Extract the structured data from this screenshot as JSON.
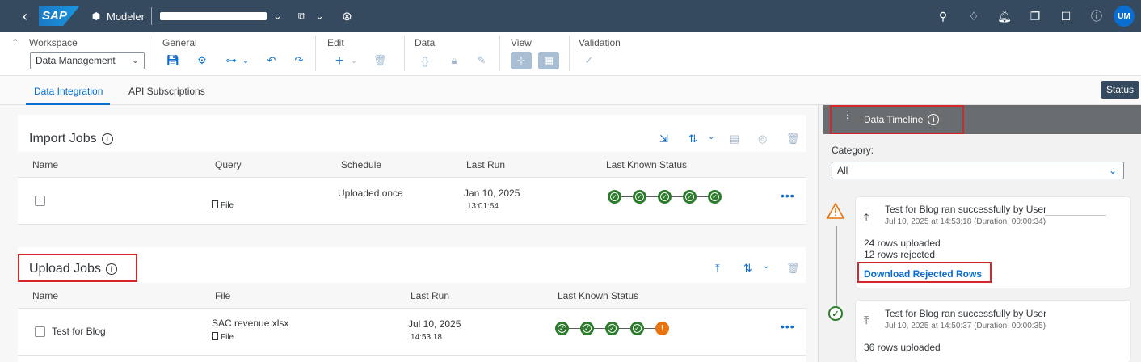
{
  "shell": {
    "logo": "SAP",
    "app_name": "Modeler",
    "avatar_initials": "UM"
  },
  "toolbar": {
    "workspace_label": "Workspace",
    "workspace_value": "Data Management",
    "general_label": "General",
    "edit_label": "Edit",
    "data_label": "Data",
    "view_label": "View",
    "validation_label": "Validation"
  },
  "tabs": {
    "data_integration": "Data Integration",
    "api_subscriptions": "API Subscriptions",
    "status_button": "Status"
  },
  "import_jobs": {
    "title": "Import Jobs",
    "columns": [
      "Name",
      "Query",
      "Schedule",
      "Last Run",
      "Last Known Status"
    ],
    "rows": [
      {
        "name": "",
        "query_type": "File",
        "schedule": "Uploaded once",
        "last_run_date": "Jan 10, 2025",
        "last_run_time": "13:01:54",
        "statuses": [
          "success",
          "success",
          "success",
          "success",
          "success"
        ]
      }
    ]
  },
  "upload_jobs": {
    "title": "Upload Jobs",
    "columns": [
      "Name",
      "File",
      "Last Run",
      "Last Known Status"
    ],
    "rows": [
      {
        "name": "Test for Blog",
        "file": "SAC revenue.xlsx",
        "file_type": "File",
        "last_run_date": "Jul 10, 2025",
        "last_run_time": "14:53:18",
        "statuses": [
          "success",
          "success",
          "success",
          "success",
          "warning"
        ]
      }
    ]
  },
  "timeline": {
    "title": "Data Timeline",
    "category_label": "Category:",
    "category_value": "All",
    "entries": [
      {
        "status": "warning",
        "message": "Test for Blog ran successfully by User",
        "meta": "Jul 10, 2025 at 14:53:18 (Duration: 00:00:34)",
        "uploaded": "24 rows uploaded",
        "rejected": "12 rows rejected",
        "link": "Download Rejected Rows"
      },
      {
        "status": "success",
        "message": "Test for Blog ran successfully by User",
        "meta": "Jul 10, 2025 at 14:50:37 (Duration: 00:00:35)",
        "uploaded": "36 rows uploaded"
      }
    ]
  },
  "colors": {
    "shell_bg": "#354a5f",
    "accent": "#0a6ed1",
    "success": "#2b7c2b",
    "warning": "#e9730c",
    "highlight_box": "#d6262b"
  }
}
